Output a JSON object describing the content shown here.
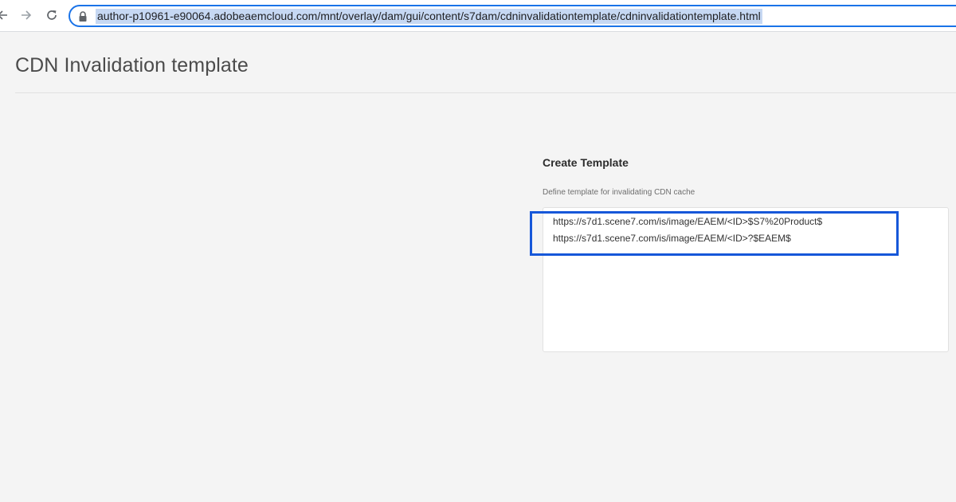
{
  "browser": {
    "icons": {
      "back": "back-arrow-icon",
      "forward": "forward-arrow-icon",
      "reload": "reload-icon",
      "lock": "lock-icon"
    },
    "url": "author-p10961-e90064.adobeaemcloud.com/mnt/overlay/dam/gui/content/s7dam/cdninvalidationtemplate/cdninvalidationtemplate.html"
  },
  "page": {
    "title": "CDN Invalidation template"
  },
  "form": {
    "heading": "Create Template",
    "label": "Define template for invalidating CDN cache",
    "template_lines": [
      "https://s7d1.scene7.com/is/image/EAEM/<ID>$S7%20Product$",
      "https://s7d1.scene7.com/is/image/EAEM/<ID>?$EAEM$"
    ]
  },
  "colors": {
    "url_selection": "#c6d8f3",
    "omnibox_focus": "#1a73e8",
    "annotation_box": "#1657d9",
    "page_background": "#f4f4f4"
  }
}
